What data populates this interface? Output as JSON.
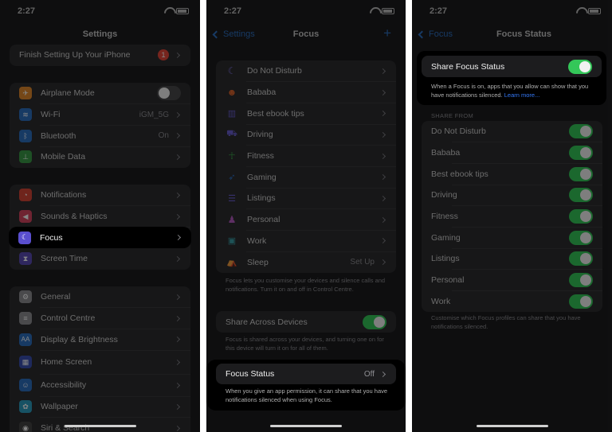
{
  "status_time": "2:27",
  "colors": {
    "toggle_on": "#34c759",
    "link": "#3478f6",
    "badge": "#e5483a"
  },
  "panel1": {
    "title": "Settings",
    "setup_row": {
      "label": "Finish Setting Up Your iPhone",
      "badge": "1"
    },
    "group1": [
      {
        "label": "Airplane Mode",
        "icon": "airplane-icon",
        "value": "",
        "toggle": "off"
      },
      {
        "label": "Wi-Fi",
        "icon": "wifi-icon",
        "value": "iGM_5G"
      },
      {
        "label": "Bluetooth",
        "icon": "bluetooth-icon",
        "value": "On"
      },
      {
        "label": "Mobile Data",
        "icon": "antenna-icon",
        "value": ""
      }
    ],
    "group2": [
      {
        "label": "Notifications",
        "icon": "bell-icon"
      },
      {
        "label": "Sounds & Haptics",
        "icon": "speaker-icon"
      },
      {
        "label": "Focus",
        "icon": "moon-icon"
      },
      {
        "label": "Screen Time",
        "icon": "hourglass-icon"
      }
    ],
    "group3": [
      {
        "label": "General",
        "icon": "gear-icon"
      },
      {
        "label": "Control Centre",
        "icon": "switches-icon"
      },
      {
        "label": "Display & Brightness",
        "icon": "text-size-icon"
      },
      {
        "label": "Home Screen",
        "icon": "grid-icon"
      },
      {
        "label": "Accessibility",
        "icon": "accessibility-icon"
      },
      {
        "label": "Wallpaper",
        "icon": "flower-icon"
      },
      {
        "label": "Siri & Search",
        "icon": "siri-icon"
      }
    ]
  },
  "panel2": {
    "back": "Settings",
    "title": "Focus",
    "plus": "+",
    "focus_list": [
      {
        "label": "Do Not Disturb",
        "icon": "moon-icon",
        "value": ""
      },
      {
        "label": "Bababa",
        "icon": "emoji-icon",
        "value": ""
      },
      {
        "label": "Best ebook tips",
        "icon": "books-icon",
        "value": ""
      },
      {
        "label": "Driving",
        "icon": "car-icon",
        "value": ""
      },
      {
        "label": "Fitness",
        "icon": "runner-icon",
        "value": ""
      },
      {
        "label": "Gaming",
        "icon": "rocket-icon",
        "value": ""
      },
      {
        "label": "Listings",
        "icon": "list-icon",
        "value": ""
      },
      {
        "label": "Personal",
        "icon": "person-icon",
        "value": ""
      },
      {
        "label": "Work",
        "icon": "badge-icon",
        "value": ""
      },
      {
        "label": "Sleep",
        "icon": "bed-icon",
        "value": "Set Up"
      }
    ],
    "focus_note": "Focus lets you customise your devices and silence calls and notifications. Turn it on and off in Control Centre.",
    "share_across": {
      "label": "Share Across Devices",
      "toggle": "on"
    },
    "share_note": "Focus is shared across your devices, and turning one on for this device will turn it on for all of them.",
    "focus_status": {
      "label": "Focus Status",
      "value": "Off"
    },
    "status_note": "When you give an app permission, it can share that you have notifications silenced when using Focus."
  },
  "panel3": {
    "back": "Focus",
    "title": "Focus Status",
    "share_status": {
      "label": "Share Focus Status",
      "toggle": "on"
    },
    "share_note": "When a Focus is on, apps that you allow can show that you have notifications silenced.",
    "learn_more": "Learn more...",
    "share_from_header": "SHARE FROM",
    "share_from": [
      {
        "label": "Do Not Disturb",
        "toggle": "on"
      },
      {
        "label": "Bababa",
        "toggle": "on"
      },
      {
        "label": "Best ebook tips",
        "toggle": "on"
      },
      {
        "label": "Driving",
        "toggle": "on"
      },
      {
        "label": "Fitness",
        "toggle": "on"
      },
      {
        "label": "Gaming",
        "toggle": "on"
      },
      {
        "label": "Listings",
        "toggle": "on"
      },
      {
        "label": "Personal",
        "toggle": "on"
      },
      {
        "label": "Work",
        "toggle": "on"
      }
    ],
    "footer_note": "Customise which Focus profiles can share that you have notifications silenced."
  }
}
